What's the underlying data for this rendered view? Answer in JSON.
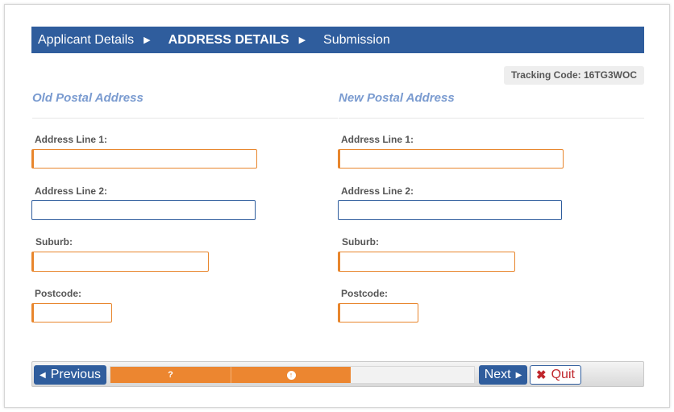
{
  "steps": [
    {
      "label": "Applicant Details",
      "active": false
    },
    {
      "label": "ADDRESS DETAILS",
      "active": true
    },
    {
      "label": "Submission",
      "active": false
    }
  ],
  "tracking": {
    "label": "Tracking Code: 16TG3WOC"
  },
  "old_address": {
    "title": "Old Postal Address",
    "line1": {
      "label": "Address Line 1:",
      "value": ""
    },
    "line2": {
      "label": "Address Line 2:",
      "value": ""
    },
    "suburb": {
      "label": "Suburb:",
      "value": ""
    },
    "postcode": {
      "label": "Postcode:",
      "value": ""
    }
  },
  "new_address": {
    "title": "New Postal Address",
    "line1": {
      "label": "Address Line 1:",
      "value": ""
    },
    "line2": {
      "label": "Address Line 2:",
      "value": ""
    },
    "suburb": {
      "label": "Suburb:",
      "value": ""
    },
    "postcode": {
      "label": "Postcode:",
      "value": ""
    }
  },
  "nav": {
    "previous_label": "Previous",
    "next_label": "Next",
    "quit_label": "Quit",
    "progress": {
      "completed_steps": 2,
      "total_steps": 3,
      "step1_icon": "?",
      "step2_icon": "arrow-up-circle-icon"
    }
  },
  "colors": {
    "primary": "#2f5d9d",
    "accent": "#ec8630",
    "section_title": "#7a9bd0",
    "quit": "#c0272d"
  }
}
